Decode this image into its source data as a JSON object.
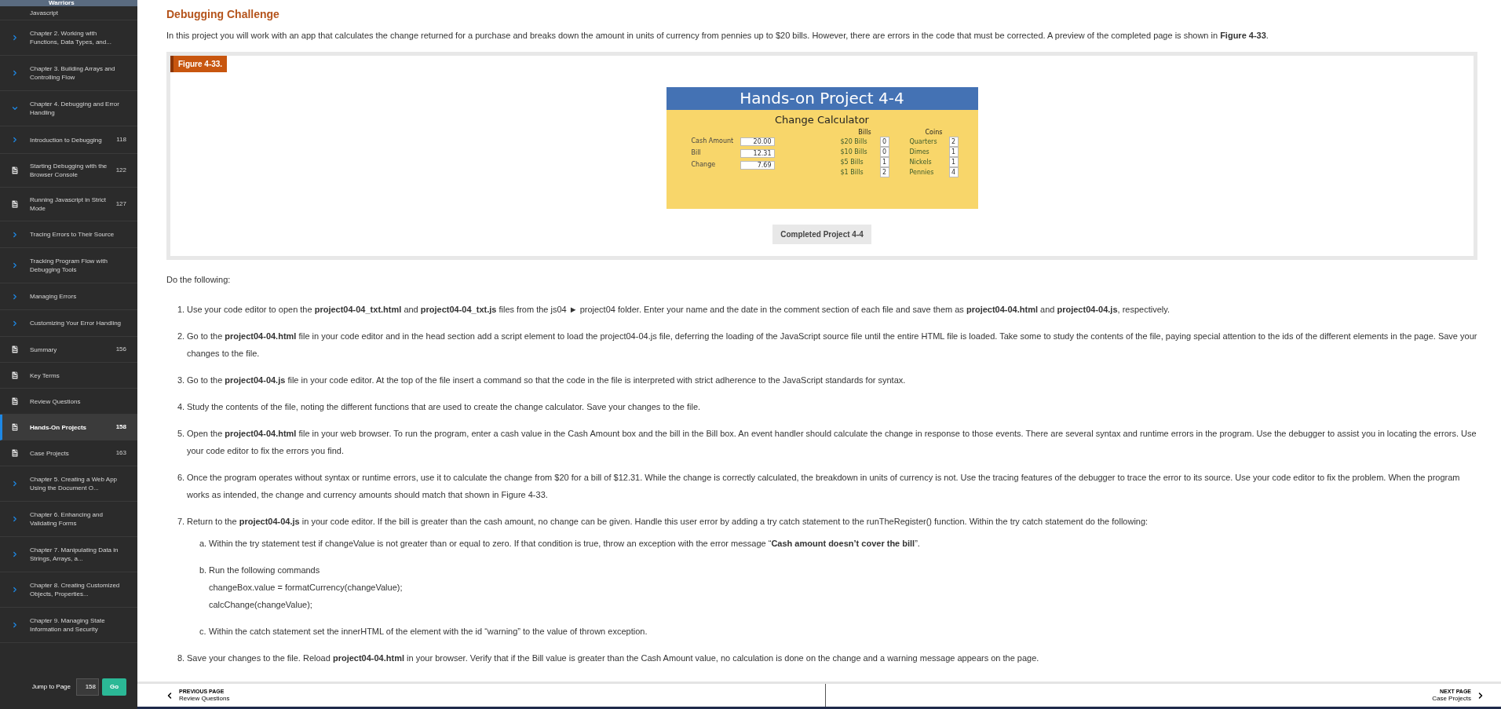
{
  "sidebar": {
    "banner_title": "Warriors",
    "items": [
      {
        "kind": "text",
        "label": "Javascript",
        "selected": false
      },
      {
        "kind": "chapter",
        "label": "Chapter 2. Working with Functions, Data Types, and...",
        "expanded": false,
        "selected": false
      },
      {
        "kind": "chapter",
        "label": "Chapter 3. Building Arrays and Controlling Flow",
        "expanded": false,
        "selected": false
      },
      {
        "kind": "chapter",
        "label": "Chapter 4. Debugging and Error Handling",
        "expanded": true,
        "selected": false,
        "children": [
          {
            "kind": "section",
            "label": "Introduction to Debugging",
            "page": "118",
            "selected": false
          },
          {
            "kind": "page",
            "label": "Starting Debugging with the Browser Console",
            "page": "122",
            "selected": false
          },
          {
            "kind": "page",
            "label": "Running Javascript in Strict Mode",
            "page": "127",
            "selected": false
          },
          {
            "kind": "section",
            "label": "Tracing Errors to Their Source",
            "selected": false
          },
          {
            "kind": "section",
            "label": "Tracking Program Flow with Debugging Tools",
            "selected": false
          },
          {
            "kind": "section",
            "label": "Managing Errors",
            "selected": false
          },
          {
            "kind": "section",
            "label": "Customizing Your Error Handling",
            "selected": false
          },
          {
            "kind": "page",
            "label": "Summary",
            "page": "156",
            "selected": false
          },
          {
            "kind": "page",
            "label": "Key Terms",
            "selected": false
          },
          {
            "kind": "page",
            "label": "Review Questions",
            "selected": false
          },
          {
            "kind": "page",
            "label": "Hands-On Projects",
            "page": "158",
            "selected": true
          },
          {
            "kind": "page",
            "label": "Case Projects",
            "page": "163",
            "selected": false
          }
        ]
      },
      {
        "kind": "chapter",
        "label": "Chapter 5. Creating a Web App Using the Document O...",
        "expanded": false,
        "selected": false
      },
      {
        "kind": "chapter",
        "label": "Chapter 6. Enhancing and Validating Forms",
        "expanded": false,
        "selected": false
      },
      {
        "kind": "chapter",
        "label": "Chapter 7. Manipulating Data in Strings, Arrays, a...",
        "expanded": false,
        "selected": false
      },
      {
        "kind": "chapter",
        "label": "Chapter 8. Creating Customized Objects, Properties...",
        "expanded": false,
        "selected": false
      },
      {
        "kind": "chapter",
        "label": "Chapter 9. Managing State Information and Security",
        "expanded": false,
        "selected": false
      }
    ],
    "jump": {
      "label": "Jump to Page",
      "value": "158",
      "button": "Go"
    }
  },
  "content": {
    "title": "Debugging Challenge",
    "intro": "In this project you will work with an app that calculates the change returned for a purchase and breaks down the amount in units of currency from pennies up to $20 bills. However, there are errors in the code that must be corrected. A preview of the completed page is shown in **Figure 4-33**.",
    "figure": {
      "label": "Figure 4-33.",
      "caption": "Completed Project 4-4",
      "app": {
        "title": "Hands-on Project 4-4",
        "subtitle": "Change Calculator",
        "fields": [
          {
            "label": "Cash Amount",
            "value": "20.00"
          },
          {
            "label": "Bill",
            "value": "12.31"
          },
          {
            "label": "Change",
            "value": "7.69"
          }
        ],
        "groups": [
          {
            "heading": "Bills",
            "rows": [
              {
                "label": "$20 Bills",
                "value": "0"
              },
              {
                "label": "$10 Bills",
                "value": "0"
              },
              {
                "label": "$5 Bills",
                "value": "1"
              },
              {
                "label": "$1 Bills",
                "value": "2"
              }
            ]
          },
          {
            "heading": "Coins",
            "rows": [
              {
                "label": "Quarters",
                "value": "2"
              },
              {
                "label": "Dimes",
                "value": "1"
              },
              {
                "label": "Nickels",
                "value": "1"
              },
              {
                "label": "Pennies",
                "value": "4"
              }
            ]
          }
        ]
      }
    },
    "lead": "Do the following:",
    "steps": [
      {
        "number": "1.",
        "text": "Use your code editor to open the **project04-04_txt.html** and **project04-04_txt.js** files from the js04 ► project04 folder. Enter your name and the date in the comment section of each file and save them as **project04-04.html** and **project04-04.js**, respectively."
      },
      {
        "number": "2.",
        "text": "Go to the **project04-04.html** file in your code editor and in the head section add a script element to load the project04-04.js file, deferring the loading of the JavaScript source file until the entire HTML file is loaded. Take some to study the contents of the file, paying special attention to the ids of the different elements in the page. Save your changes to the file."
      },
      {
        "number": "3.",
        "text": "Go to the **project04-04.js** file in your code editor. At the top of the file insert a command so that the code in the file is interpreted with strict adherence to the JavaScript standards for syntax."
      },
      {
        "number": "4.",
        "text": "Study the contents of the file, noting the different functions that are used to create the change calculator. Save your changes to the file."
      },
      {
        "number": "5.",
        "text": "Open the **project04-04.html** file in your web browser. To run the program, enter a cash value in the Cash Amount box and the bill in the Bill box. An event handler should calculate the change in response to those events. There are several syntax and runtime errors in the program. Use the debugger to assist you in locating the errors. Use your code editor to fix the errors you find."
      },
      {
        "number": "6.",
        "text": "Once the program operates without syntax or runtime errors, use it to calculate the change from $20 for a bill of $12.31. While the change is correctly calculated, the breakdown in units of currency is not. Use the tracing features of the debugger to trace the error to its source. Use your code editor to fix the problem. When the program works as intended, the change and currency amounts should match that shown in Figure 4-33."
      },
      {
        "number": "7.",
        "text": "Return to the **project04-04.js** in your code editor. If the bill is greater than the cash amount, no change can be given. Handle this user error by adding a try catch statement to the runTheRegister() function. Within the try catch statement do the following:",
        "substeps": [
          {
            "letter": "a.",
            "text": "Within the try statement test if changeValue is not greater than or equal to zero. If that condition is true, throw an exception with the error message “**Cash amount doesn’t cover the bill**”."
          },
          {
            "letter": "b.",
            "text": "Run the following commands",
            "code_lines": [
              "changeBox.value = formatCurrency(changeValue);",
              "calcChange(changeValue);"
            ]
          },
          {
            "letter": "c.",
            "text": "Within the catch statement set the innerHTML of the element with the id “warning” to the value of thrown exception."
          }
        ]
      },
      {
        "number": "8.",
        "text": "Save your changes to the file. Reload **project04-04.html** in your browser. Verify that if the Bill value is greater than the Cash Amount value, no calculation is done on the change and a warning message appears on the page."
      }
    ]
  },
  "footer": {
    "previous": {
      "caption": "PREVIOUS PAGE",
      "title": "Review Questions"
    },
    "next": {
      "caption": "NEXT PAGE",
      "title": "Case Projects"
    }
  }
}
